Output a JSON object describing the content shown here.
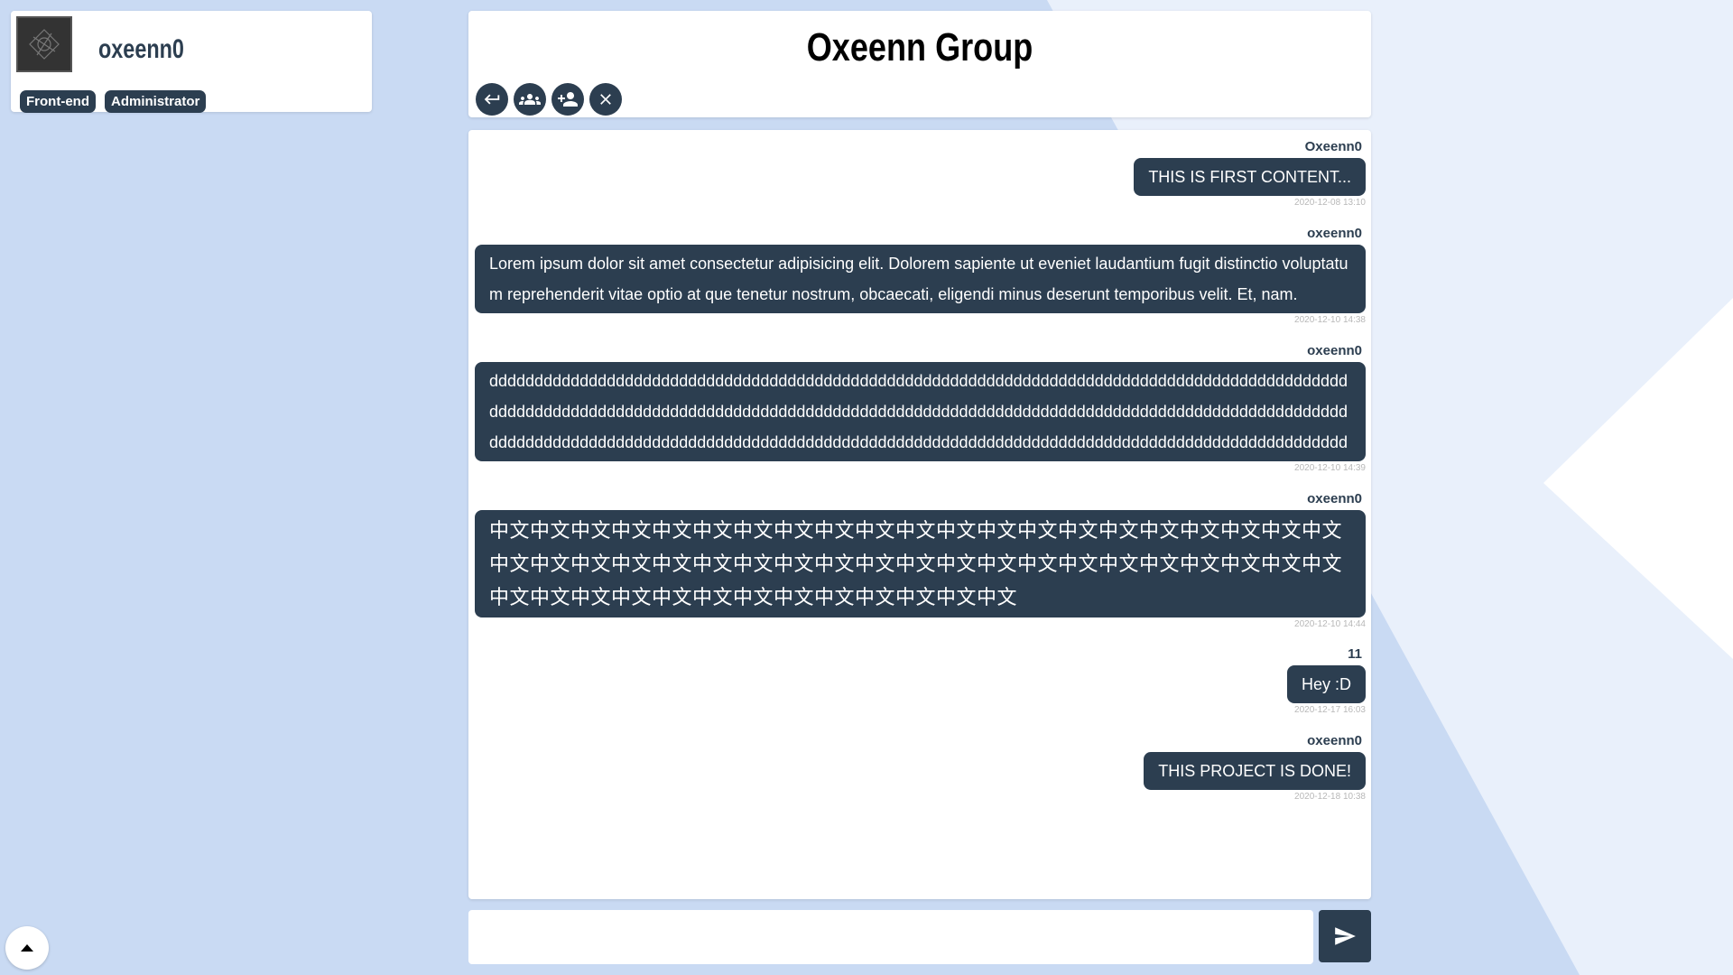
{
  "profile": {
    "username": "oxeenn0",
    "badges": [
      "Front-end",
      "Administrator"
    ]
  },
  "header": {
    "group_name": "Oxeenn Group",
    "actions": [
      "back-icon",
      "members-icon",
      "add-member-icon",
      "close-icon"
    ]
  },
  "messages": [
    {
      "sender": "Oxeenn0",
      "text": "THIS IS FIRST CONTENT...",
      "time": "2020-12-08 13:10"
    },
    {
      "sender": "oxeenn0",
      "text": "Lorem ipsum dolor sit amet consectetur adipisicing elit. Dolorem sapiente ut eveniet laudantium fugit distinctio voluptatum reprehenderit vitae optio at que tenetur nostrum, obcaecati, eligendi minus deserunt temporibus velit. Et, nam.",
      "time": "2020-12-10 14:38"
    },
    {
      "sender": "oxeenn0",
      "text": "ddddddddddddddddddddddddddddddddddddddddddddddddddddddddddddddddddddddddddddddddddddddddddddddddddddddddddddddddddddddddddddddddddddddddddddddddddddddddddddddddddddddddddddddddddddddddddddddddddddddddddddddddddddddddddddddddddddddddddddddddddddddddddddddddddddddddddddddddddddddddddddd",
      "time": "2020-12-10 14:39"
    },
    {
      "sender": "oxeenn0",
      "text": "中文中文中文中文中文中文中文中文中文中文中文中文中文中文中文中文中文中文中文中文中文中文中文中文中文中文中文中文中文中文中文中文中文中文中文中文中文中文中文中文中文中文中文中文中文中文中文中文中文中文中文中文中文中文中文",
      "time": "2020-12-10 14:44"
    },
    {
      "sender": "11",
      "text": "Hey :D",
      "time": "2020-12-17 16:03"
    },
    {
      "sender": "oxeenn0",
      "text": "THIS PROJECT IS DONE!",
      "time": "2020-12-18 10:38"
    }
  ],
  "composer": {
    "placeholder": "",
    "value": ""
  },
  "icons": {
    "send": "send-icon",
    "scroll_top": "chevron-up-icon"
  },
  "colors": {
    "accent": "#2c3e50",
    "background": "#c9daf3"
  }
}
